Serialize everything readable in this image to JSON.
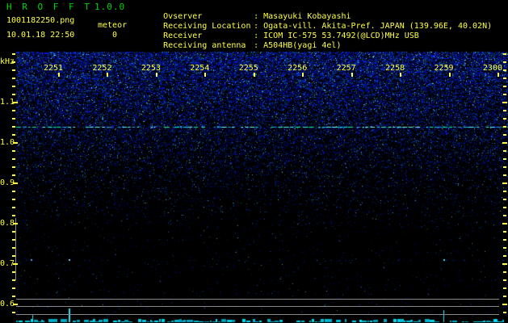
{
  "app": {
    "name": "H R O F F T",
    "version": "1.0.0"
  },
  "header": {
    "filename": "1001182250.png",
    "mode": "meteor",
    "count": "0",
    "timestamp": "10.01.18 22:50",
    "separator": ": ",
    "info_rows": [
      {
        "label": "Ovserver",
        "value": "Masayuki Kobayashi"
      },
      {
        "label": "Receiving Location",
        "value": "Ogata-vill. Akita-Pref. JAPAN (139.96E, 40.02N)"
      },
      {
        "label": "Receiver",
        "value": "ICOM IC-575 53.7492(@LCD)MHz USB"
      },
      {
        "label": "Receiving antenna",
        "value": "A504HB(yagi 4el)"
      }
    ]
  },
  "chart_data": {
    "type": "heatmap",
    "title": "HROFFT 10-minute radio meteor echo spectrogram",
    "x": {
      "tick_labels": [
        "2251",
        "2252",
        "2253",
        "2254",
        "2255",
        "2256",
        "2257",
        "2258",
        "2259",
        "2300"
      ],
      "start": "22:51",
      "end": "23:00",
      "minutes_per_division": 1
    },
    "y": {
      "unit": "kHz",
      "tick_labels": [
        "1.1",
        "1.0",
        "0.9",
        "0.8",
        "0.7",
        "0.6"
      ],
      "min": 0.58,
      "max": 1.22,
      "major_step_khz": 0.1,
      "minor_step_khz": 0.02
    },
    "features": [
      {
        "name": "direct-carrier-line",
        "freq_khz": 1.04,
        "appearance": "bright dashed cyan-green horizontal line across full width"
      },
      {
        "name": "noise-background",
        "appearance": "dense blue speckle noise above ~1.0 kHz fading to black toward lower frequencies"
      },
      {
        "name": "faint-dot-row",
        "freq_khz": 0.71,
        "appearance": "sparse faint blue dots across full width"
      },
      {
        "name": "echo-dots",
        "freq_khz": 0.71,
        "points_time_fraction": [
          0.03,
          0.107,
          0.868
        ]
      }
    ],
    "level_plot": {
      "reference_lines": 3,
      "trace_appearance": "noisy cyan baseline along bottom edge",
      "spike_time_fractions": [
        0.033,
        0.107,
        0.868
      ]
    },
    "meteor_count": 0
  },
  "colors": {
    "label_yellow": "#ffff44",
    "title_green": "#00d400",
    "trace_cyan": "#00c8d8",
    "grid_gray": "#8a8a8a",
    "noise_blue": "#2233ff"
  }
}
